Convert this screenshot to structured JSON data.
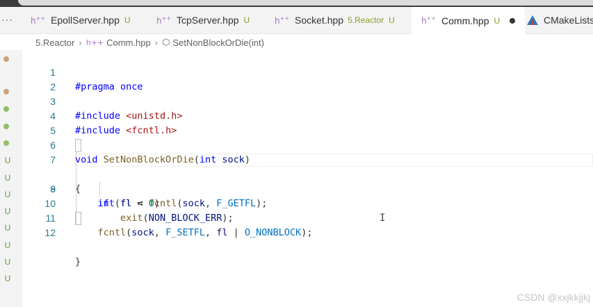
{
  "tabs": [
    {
      "label": "EpollServer.hpp",
      "status": "U",
      "icon": "header-file-icon"
    },
    {
      "label": "TcpServer.hpp",
      "status": "U",
      "icon": "header-file-icon"
    },
    {
      "label": "Socket.hpp",
      "folder": "5.Reactor",
      "status": "U",
      "icon": "header-file-icon"
    },
    {
      "label": "Comm.hpp",
      "status": "U",
      "icon": "header-file-icon",
      "active": true,
      "modified": true
    },
    {
      "label": "CMakeLists",
      "icon": "cmake-icon"
    }
  ],
  "more_label": "···",
  "header_icon_text": "h",
  "breadcrumb": {
    "folder": "5.Reactor",
    "file": "Comm.hpp",
    "symbol": "SetNonBlockOrDie(int)"
  },
  "gutter_marks": [
    "U",
    "U",
    "U",
    "U",
    "U",
    "U",
    "U",
    "U"
  ],
  "lines": [
    {
      "num": "1",
      "text": "#pragma once"
    },
    {
      "num": "2",
      "text": ""
    },
    {
      "num": "3",
      "text": "#include <unistd.h>"
    },
    {
      "num": "4",
      "text": "#include <fcntl.h>"
    },
    {
      "num": "5",
      "text": ""
    },
    {
      "num": "6",
      "text": "void SetNonBlockOrDie(int sock)"
    },
    {
      "num": "7",
      "text": "{"
    },
    {
      "num": "8",
      "text": "    int fl = fcntl(sock, F_GETFL);"
    },
    {
      "num": "9",
      "text": "    if (fl < 0)"
    },
    {
      "num": "10",
      "text": "        exit(NON_BLOCK_ERR);"
    },
    {
      "num": "11",
      "text": "    fcntl(sock, F_SETFL, fl | O_NONBLOCK);"
    },
    {
      "num": "12",
      "text": "}"
    }
  ],
  "watermark": "CSDN @xxjkkjjkj",
  "colors": {
    "keyword": "#0000ff",
    "string": "#a31515",
    "function": "#795e26",
    "param": "#001080",
    "macro": "#0070c1",
    "number": "#098658",
    "line_number": "#237893",
    "git_untracked": "#5e9e3a"
  }
}
